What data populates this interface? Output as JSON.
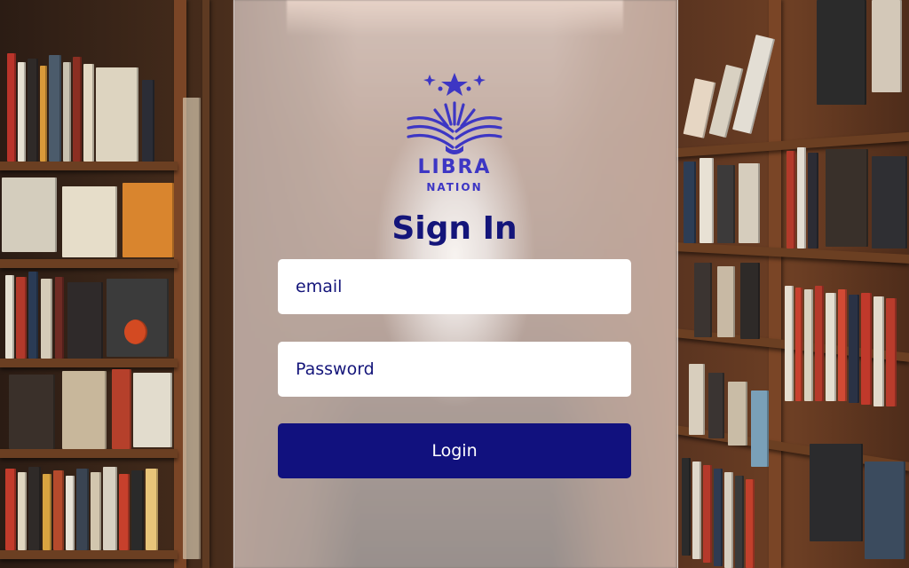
{
  "brand": {
    "name": "LIBRA",
    "subtitle": "NATION",
    "logo_icon": "open-book-star-icon",
    "color": "#3d36c4"
  },
  "login_form": {
    "title": "Sign In",
    "email_placeholder": "email",
    "password_placeholder": "Password",
    "submit_label": "Login",
    "accent_color": "#11117e"
  },
  "background": {
    "description_icon": "bookshelf-photo"
  }
}
